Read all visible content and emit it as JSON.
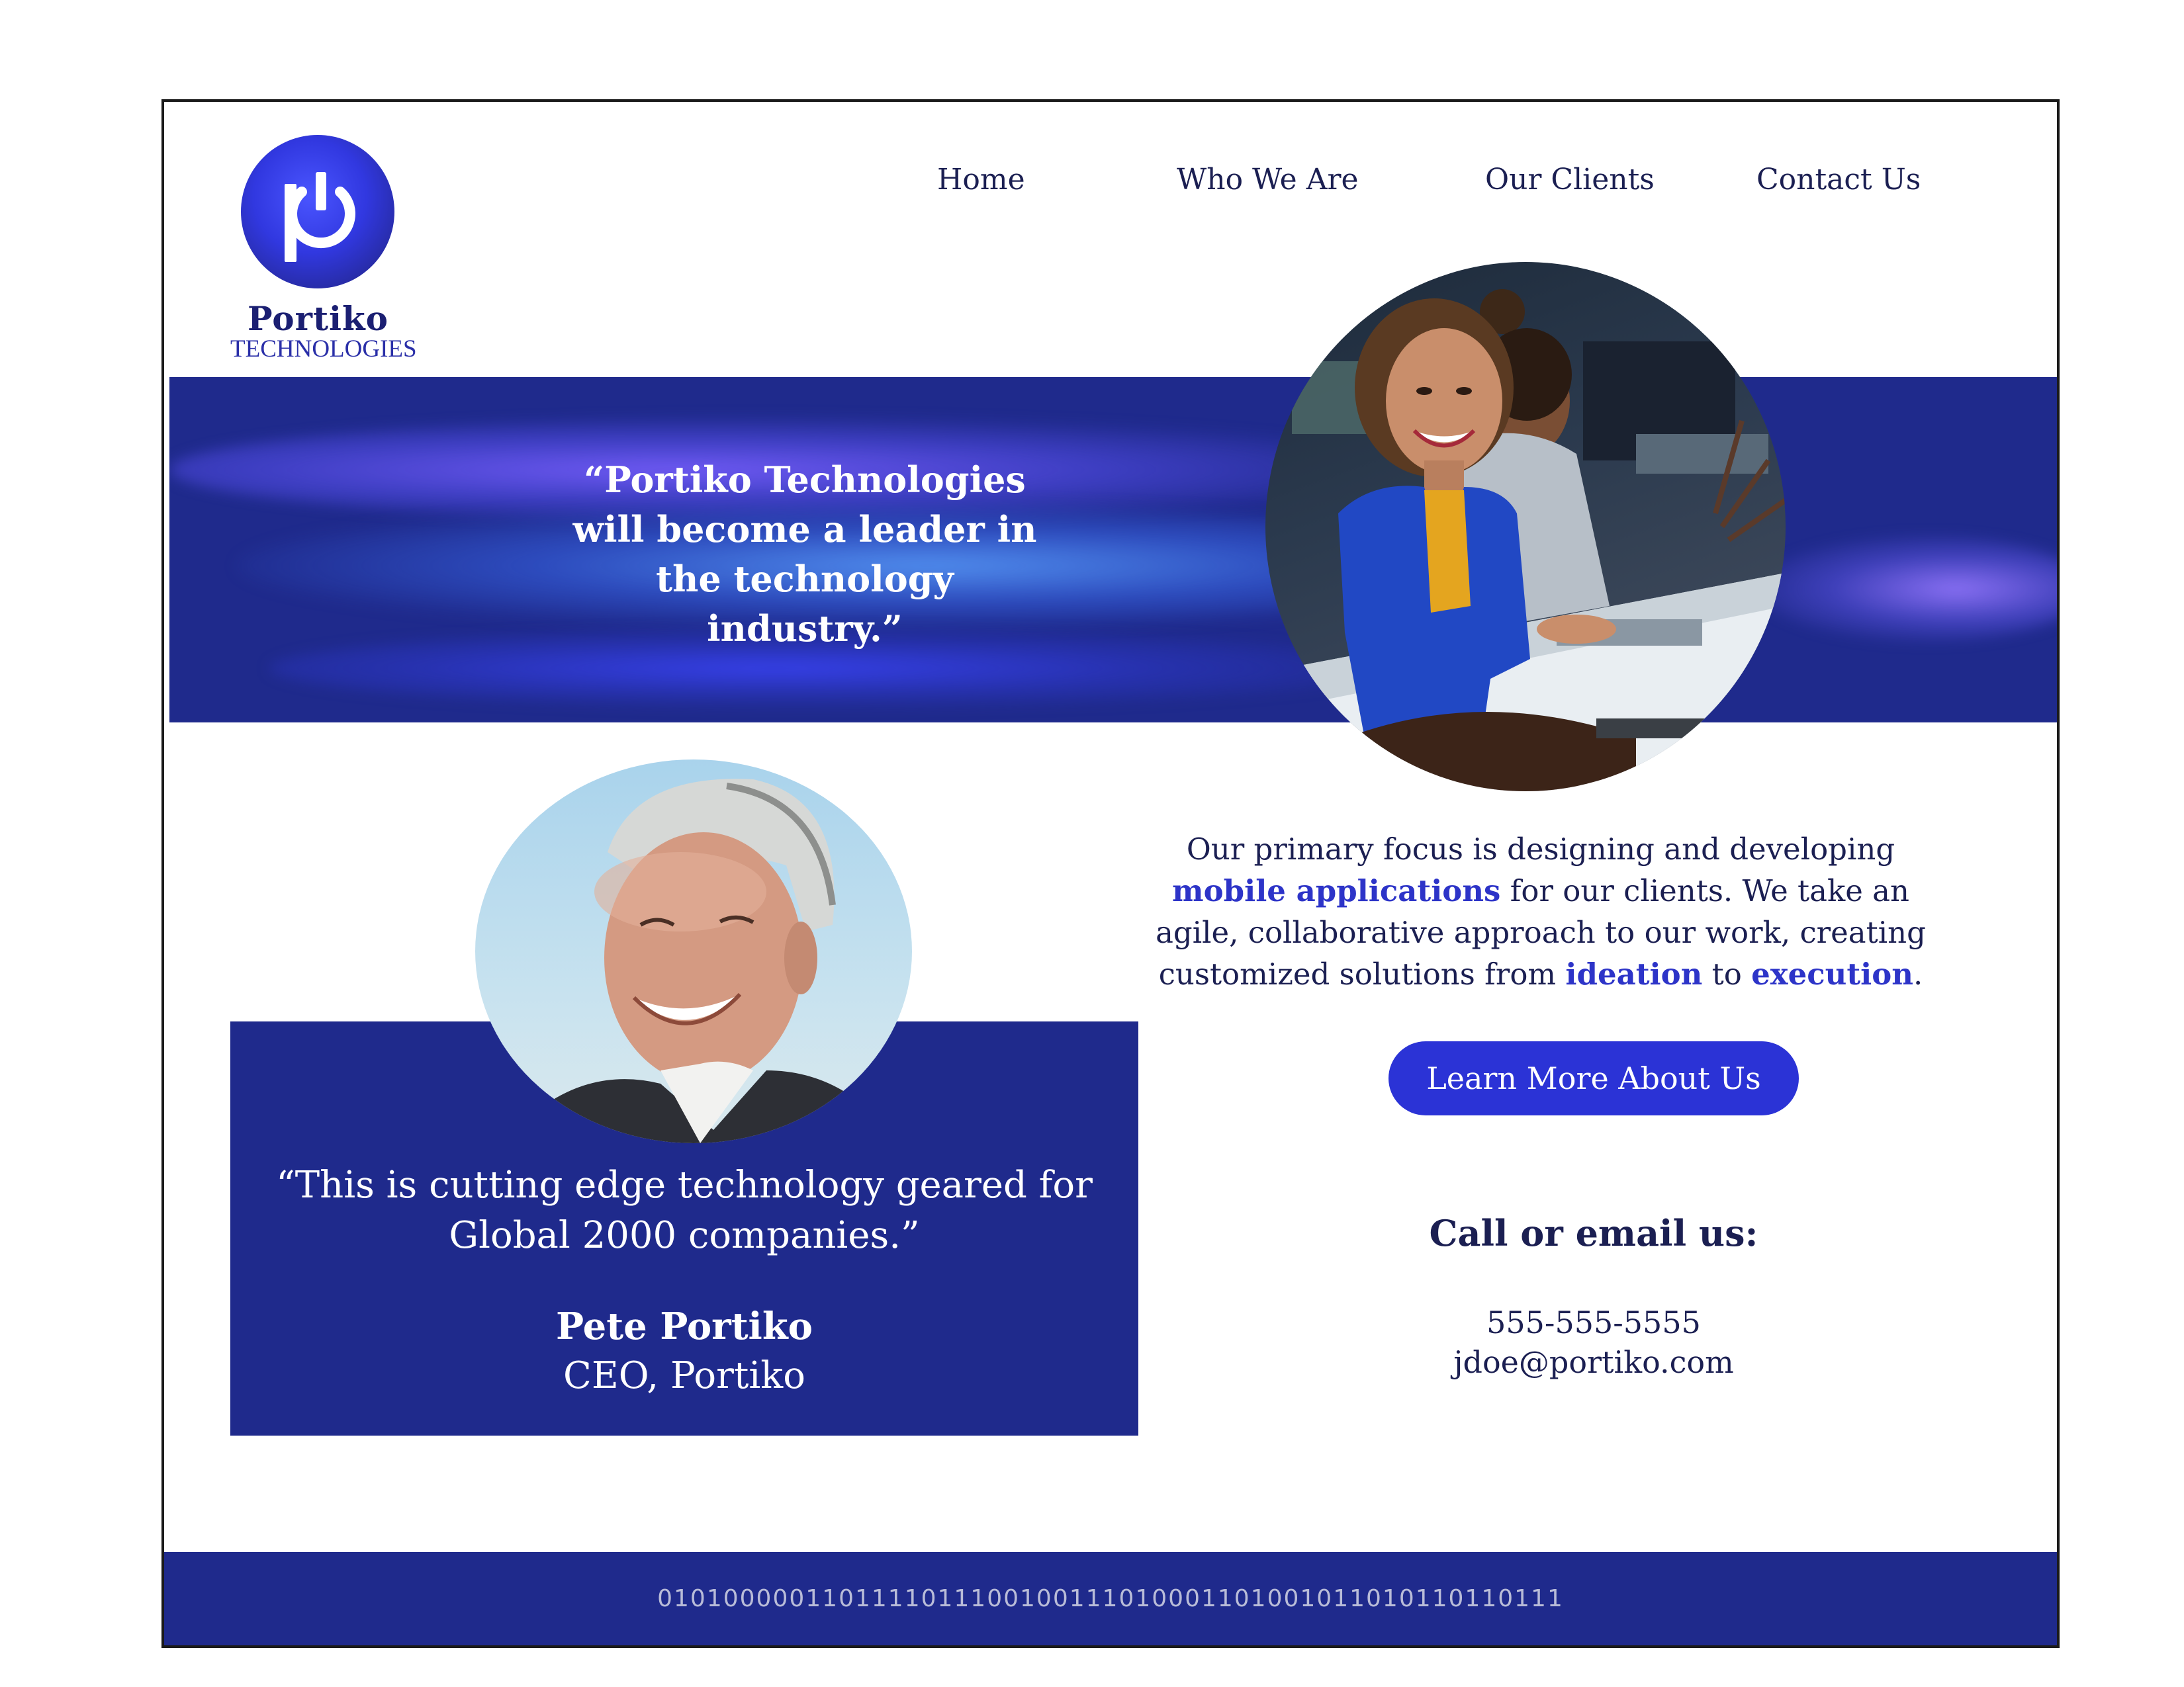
{
  "brand": {
    "name": "Portiko",
    "subtitle": "TECHNOLOGIES"
  },
  "nav": {
    "items": [
      {
        "label": "Home"
      },
      {
        "label": "Who We Are"
      },
      {
        "label": "Our Clients"
      },
      {
        "label": "Contact Us"
      }
    ]
  },
  "hero": {
    "quote": "“Portiko Technologies will become a leader in the technology industry.”"
  },
  "testimonial": {
    "quote": "“This is cutting edge technology geared for Global 2000 companies.”",
    "name": "Pete Portiko",
    "role": "CEO, Portiko"
  },
  "about": {
    "part1": "Our primary focus is designing and developing ",
    "highlight1": "mobile applications",
    "part2": " for our clients. We take an agile, collaborative approach to our work, creating customized solutions from ",
    "highlight2": "ideation",
    "part3": " to ",
    "highlight3": "execution",
    "part4": "."
  },
  "cta": {
    "label": "Learn More About Us"
  },
  "contact": {
    "heading": "Call or email us:",
    "phone": "555-555-5555",
    "email": "jdoe@portiko.com"
  },
  "footer": {
    "binary": "0101000001101111011100100111010001101001011010110110111"
  },
  "colors": {
    "navy": "#1f2a8c",
    "accent": "#2b33d6",
    "highlight_text": "#2d34c8",
    "text": "#1b1f52"
  },
  "icons": {
    "logo": "power-p-logo-icon"
  }
}
